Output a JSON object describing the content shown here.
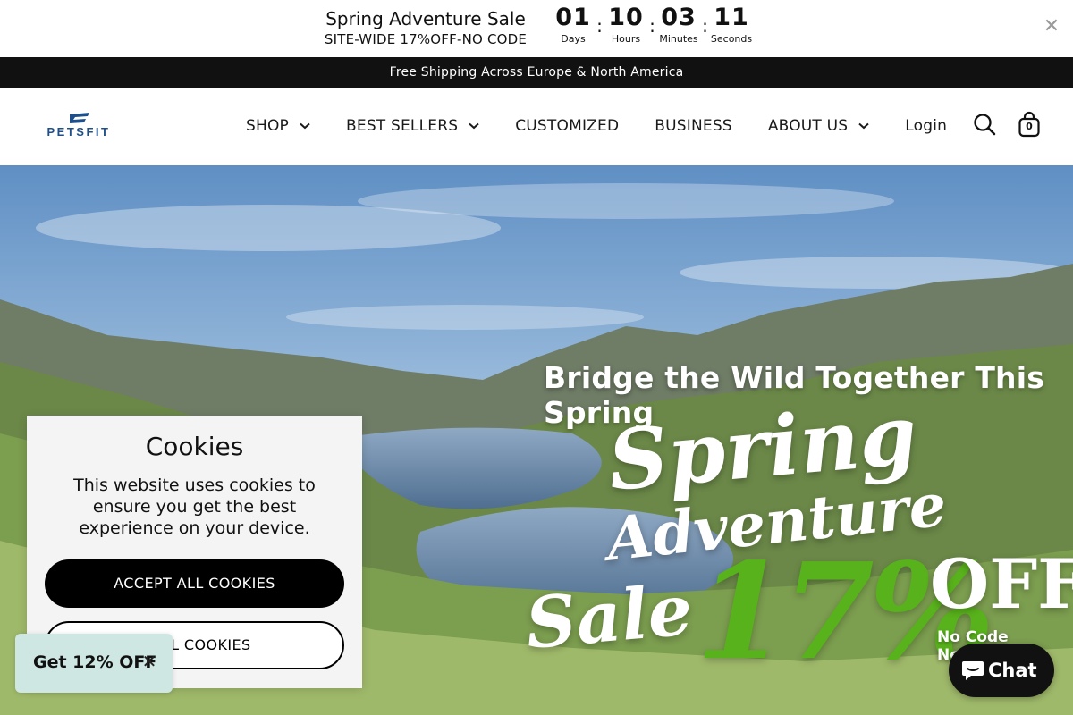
{
  "promo": {
    "title": "Spring Adventure Sale",
    "subtitle": "SITE-WIDE 17%OFF-NO CODE",
    "countdown": [
      {
        "value": "01",
        "label": "Days"
      },
      {
        "value": "10",
        "label": "Hours"
      },
      {
        "value": "03",
        "label": "Minutes"
      },
      {
        "value": "11",
        "label": "Seconds"
      }
    ],
    "separator": ":",
    "close_icon": "close-icon"
  },
  "shipping_banner": "Free Shipping Across Europe & North America",
  "header": {
    "logo_text": "PETSFIT",
    "nav": [
      {
        "label": "SHOP",
        "dropdown": true
      },
      {
        "label": "BEST SELLERS",
        "dropdown": true
      },
      {
        "label": "CUSTOMIZED",
        "dropdown": false
      },
      {
        "label": "BUSINESS",
        "dropdown": false
      },
      {
        "label": "ABOUT US",
        "dropdown": true
      },
      {
        "label": "Login",
        "dropdown": false
      }
    ],
    "search_icon": "search-icon",
    "cart_icon": "bag-icon",
    "cart_count": "0"
  },
  "hero": {
    "tagline": "Bridge the Wild Together This Spring",
    "line1": "Spring",
    "line2": "Adventure",
    "line3": "Sale",
    "percent": "17%",
    "off": "OFF",
    "note": "No Code Needed",
    "accent_color": "#58b21b"
  },
  "cookie_dialog": {
    "title": "Cookies",
    "body": "This website uses cookies to ensure you get the best experience on your device.",
    "accept_label": "ACCEPT ALL COOKIES",
    "reject_label": "E ALL COOKIES"
  },
  "discount_popup": {
    "label": "Get 12% OFF",
    "close_icon": "close-icon"
  },
  "chat": {
    "label": "Chat",
    "icon": "chat-bubble-icon"
  }
}
